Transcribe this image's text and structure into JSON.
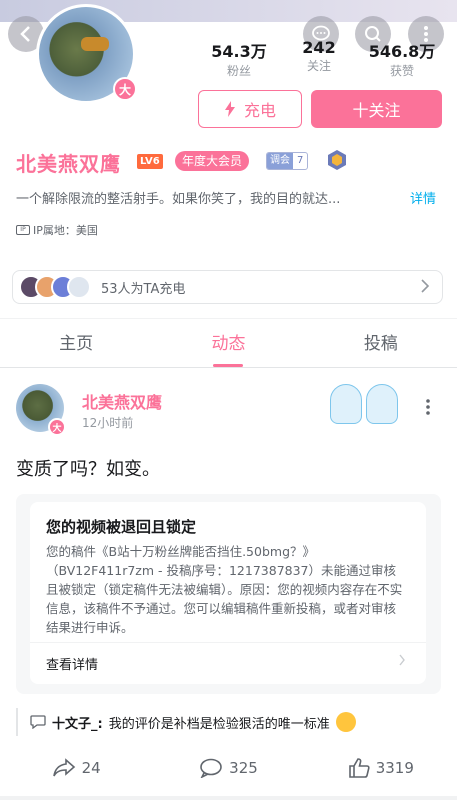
{
  "header": {
    "back_icon": "chevron-left-icon",
    "message_icon": "chat-bubble-icon",
    "search_icon": "search-icon",
    "more_icon": "more-vertical-icon"
  },
  "profile": {
    "vip_badge": "大",
    "stats": [
      {
        "value": "54.3万",
        "label": "粉丝"
      },
      {
        "value": "242",
        "label": "关注"
      },
      {
        "value": "546.8万",
        "label": "获赞"
      }
    ],
    "charge_button": "充电",
    "follow_button": "十关注",
    "name": "北美燕双鹰",
    "level": "LV6",
    "annual_member": "年度大会员",
    "medal_name": "调会",
    "medal_level": "7",
    "bio": "一个解除限流的整活射手。如果你笑了，我的目的就达...",
    "bio_detail": "详情",
    "ip_icon_text": "IP",
    "ip_location": "IP属地：美国"
  },
  "charge_bar": {
    "text": "53人为TA充电"
  },
  "tabs": [
    "主页",
    "动态",
    "投稿"
  ],
  "active_tab": "动态",
  "post": {
    "author": "北美燕双鹰",
    "time": "12小时前",
    "content": "变质了吗？如变。",
    "card": {
      "title": "您的视频被退回且锁定",
      "body": "您的稿件《B站十万粉丝牌能否挡住.50bmg？》（BV12F411r7zm - 投稿序号：1217387837）未能通过审核且被锁定（锁定稿件无法被编辑）。原因：您的视频内容存在不实信息，该稿件不予通过。您可以编辑稿件重新投稿，或者对审核结果进行申诉。",
      "link": "查看详情"
    },
    "comment": {
      "author": "十文子_:",
      "text": "我的评价是补档是检验狠活的唯一标准"
    },
    "actions": {
      "share": "24",
      "comments": "325",
      "likes": "3319"
    }
  },
  "colors": {
    "accent": "#fb7299",
    "link": "#00aeec"
  }
}
